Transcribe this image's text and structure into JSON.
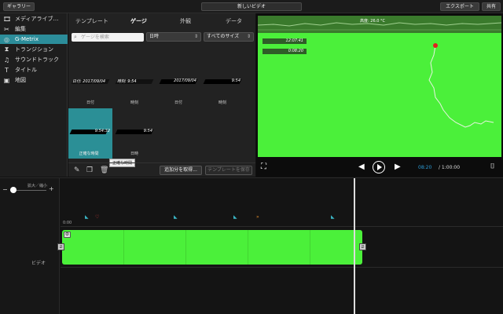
{
  "topbar": {
    "gallery_label": "ギャラリー",
    "project_title": "新しいビデオ",
    "export_label": "エクスポート",
    "share_label": "共有"
  },
  "sidebar": {
    "items": [
      {
        "label": "メディアライブ…",
        "icon": "film-icon"
      },
      {
        "label": "編集",
        "icon": "scissors-icon"
      },
      {
        "label": "G-Metrix",
        "icon": "gmetrix-icon"
      },
      {
        "label": "トランジション",
        "icon": "transition-icon"
      },
      {
        "label": "サウンドトラック",
        "icon": "music-note-icon"
      },
      {
        "label": "タイトル",
        "icon": "title-t-icon"
      },
      {
        "label": "地図",
        "icon": "map-icon"
      }
    ]
  },
  "browser": {
    "tabs": [
      "テンプレート",
      "ゲージ",
      "外観",
      "データ"
    ],
    "search_placeholder": "ゲージを検索",
    "filter_value": "日時",
    "size_value": "すべてのサイズ",
    "gauges": [
      {
        "value": "",
        "caption": "日付",
        "prefix": "日付: 2017/09/04"
      },
      {
        "value": "",
        "caption": "時刻",
        "prefix": "時刻: 9:54"
      },
      {
        "value": "2017/09/04",
        "caption": "日付"
      },
      {
        "value": "9:54",
        "caption": "時刻"
      },
      {
        "value": "9:54:32",
        "caption": "正確な時間"
      },
      {
        "value": "9:54",
        "caption": "日時"
      }
    ],
    "tooltip": "正確な時間",
    "add_button": "追加分を取得...",
    "save_template": "テンプレートを保存"
  },
  "viewer": {
    "elevation_label": "高度: 26.0 °C",
    "telemetry_time": "12:07:41",
    "telemetry_elapsed": "0:08:20",
    "time_current": "08:20",
    "time_total": "/ 1:00:00"
  },
  "timeline": {
    "zoom_label": "拡大／縮小",
    "zero_label": "0:00",
    "track_label": "ビデオ"
  },
  "colors": {
    "accent": "#2c8d9a",
    "green_screen": "#4bf03a",
    "time_blue": "#2c9bd6"
  }
}
